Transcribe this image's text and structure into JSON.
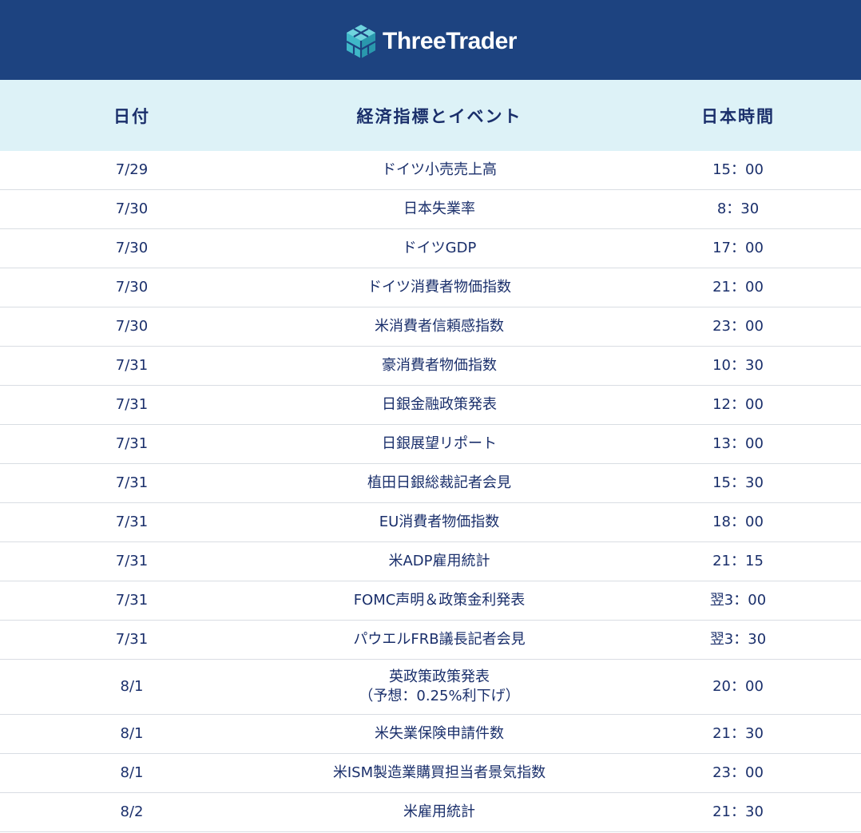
{
  "brand": {
    "name": "ThreeTrader"
  },
  "header": {
    "date": "日付",
    "event": "経済指標とイベント",
    "time": "日本時間"
  },
  "rows": [
    {
      "date": "7/29",
      "event": "ドイツ小売売上高",
      "time": "15：00"
    },
    {
      "date": "7/30",
      "event": "日本失業率",
      "time": "8：30"
    },
    {
      "date": "7/30",
      "event": "ドイツGDP",
      "time": "17：00"
    },
    {
      "date": "7/30",
      "event": "ドイツ消費者物価指数",
      "time": "21：00"
    },
    {
      "date": "7/30",
      "event": "米消費者信頼感指数",
      "time": "23：00"
    },
    {
      "date": "7/31",
      "event": "豪消費者物価指数",
      "time": "10：30"
    },
    {
      "date": "7/31",
      "event": "日銀金融政策発表",
      "time": "12：00"
    },
    {
      "date": "7/31",
      "event": "日銀展望リポート",
      "time": "13：00"
    },
    {
      "date": "7/31",
      "event": "植田日銀総裁記者会見",
      "time": "15：30"
    },
    {
      "date": "7/31",
      "event": "EU消費者物価指数",
      "time": "18：00"
    },
    {
      "date": "7/31",
      "event": "米ADP雇用統計",
      "time": "21：15"
    },
    {
      "date": "7/31",
      "event": "FOMC声明＆政策金利発表",
      "time": "翌3：00"
    },
    {
      "date": "7/31",
      "event": "パウエルFRB議長記者会見",
      "time": "翌3：30"
    },
    {
      "date": "8/1",
      "event": "英政策政策発表\n（予想：0.25%利下げ）",
      "time": "20：00"
    },
    {
      "date": "8/1",
      "event": "米失業保険申請件数",
      "time": "21：30"
    },
    {
      "date": "8/1",
      "event": "米ISM製造業購買担当者景気指数",
      "time": "23：00"
    },
    {
      "date": "8/2",
      "event": "米雇用統計",
      "time": "21：30"
    }
  ]
}
